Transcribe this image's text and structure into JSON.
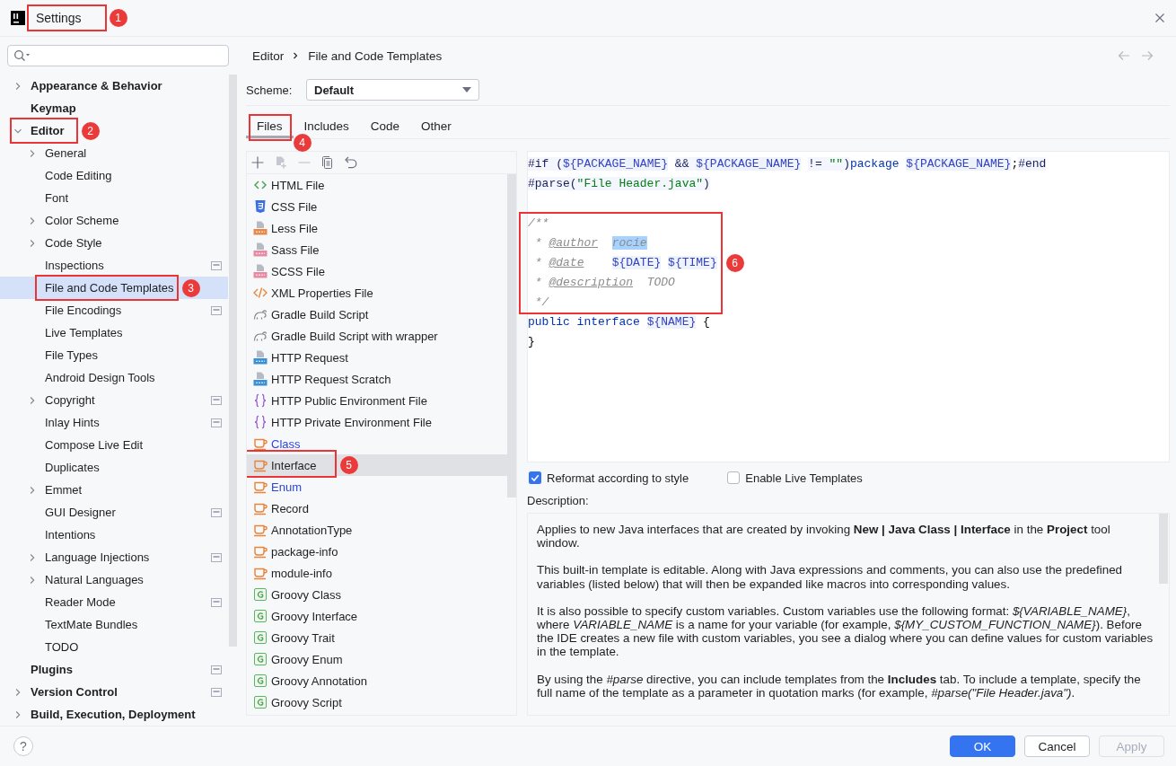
{
  "window": {
    "title": "Settings",
    "callout": "1"
  },
  "sidebar": {
    "items": [
      {
        "label": "Appearance & Behavior",
        "selected": false,
        "expanded": false
      },
      {
        "label": "Keymap",
        "selected": false
      },
      {
        "label": "Editor",
        "selected": false,
        "expanded": true,
        "callout": "2",
        "children": [
          {
            "label": "General",
            "selected": false,
            "expanded": false
          },
          {
            "label": "Code Editing",
            "selected": false
          },
          {
            "label": "Font",
            "selected": false
          },
          {
            "label": "Color Scheme",
            "selected": false,
            "expanded": false
          },
          {
            "label": "Code Style",
            "selected": false,
            "expanded": false
          },
          {
            "label": "Inspections",
            "selected": false,
            "project_level": true
          },
          {
            "label": "File and Code Templates",
            "selected": true,
            "callout": "3"
          },
          {
            "label": "File Encodings",
            "selected": false,
            "project_level": true
          },
          {
            "label": "Live Templates",
            "selected": false
          },
          {
            "label": "File Types",
            "selected": false
          },
          {
            "label": "Android Design Tools",
            "selected": false
          },
          {
            "label": "Copyright",
            "selected": false,
            "expanded": false,
            "project_level": true
          },
          {
            "label": "Inlay Hints",
            "selected": false,
            "project_level": true
          },
          {
            "label": "Compose Live Edit",
            "selected": false
          },
          {
            "label": "Duplicates",
            "selected": false
          },
          {
            "label": "Emmet",
            "selected": false,
            "expanded": false
          },
          {
            "label": "GUI Designer",
            "selected": false,
            "project_level": true
          },
          {
            "label": "Intentions",
            "selected": false
          },
          {
            "label": "Language Injections",
            "selected": false,
            "expanded": false,
            "project_level": true
          },
          {
            "label": "Natural Languages",
            "selected": false,
            "expanded": false
          },
          {
            "label": "Reader Mode",
            "selected": false,
            "project_level": true
          },
          {
            "label": "TextMate Bundles",
            "selected": false
          },
          {
            "label": "TODO",
            "selected": false
          }
        ]
      },
      {
        "label": "Plugins",
        "selected": false,
        "project_level": true
      },
      {
        "label": "Version Control",
        "selected": false,
        "expanded": false,
        "project_level": true
      },
      {
        "label": "Build, Execution, Deployment",
        "selected": false,
        "expanded": false
      }
    ]
  },
  "breadcrumb": {
    "items": [
      "Editor",
      "File and Code Templates"
    ],
    "nav_buttons": [
      {
        "kind": "back",
        "disabled": true
      },
      {
        "kind": "forward",
        "disabled": true
      }
    ]
  },
  "scheme": {
    "label": "Scheme:",
    "value": "Default"
  },
  "tabs": [
    {
      "label": "Files",
      "selected": true,
      "callout": "4"
    },
    {
      "label": "Includes",
      "selected": false
    },
    {
      "label": "Code",
      "selected": false
    },
    {
      "label": "Other",
      "selected": false
    }
  ],
  "templates": {
    "toolbar": [
      {
        "kind": "add",
        "disabled": false
      },
      {
        "kind": "add_child",
        "disabled": true
      },
      {
        "kind": "remove",
        "disabled": true
      },
      {
        "kind": "copy",
        "disabled": false
      },
      {
        "kind": "reset",
        "disabled": false
      }
    ],
    "items": [
      {
        "name": "HTML File",
        "kind": "html",
        "selected": false,
        "modified": false
      },
      {
        "name": "CSS File",
        "kind": "css",
        "selected": false,
        "modified": false
      },
      {
        "name": "Less File",
        "kind": "less",
        "selected": false,
        "modified": false
      },
      {
        "name": "Sass File",
        "kind": "sass",
        "selected": false,
        "modified": false
      },
      {
        "name": "SCSS File",
        "kind": "sass",
        "selected": false,
        "modified": false
      },
      {
        "name": "XML Properties File",
        "kind": "xml",
        "selected": false,
        "modified": false
      },
      {
        "name": "Gradle Build Script",
        "kind": "gradle",
        "selected": false,
        "modified": false
      },
      {
        "name": "Gradle Build Script with wrapper",
        "kind": "gradle",
        "selected": false,
        "modified": false
      },
      {
        "name": "HTTP Request",
        "kind": "api",
        "selected": false,
        "modified": false
      },
      {
        "name": "HTTP Request Scratch",
        "kind": "api",
        "selected": false,
        "modified": false
      },
      {
        "name": "HTTP Public Environment File",
        "kind": "env",
        "selected": false,
        "modified": false
      },
      {
        "name": "HTTP Private Environment File",
        "kind": "env",
        "selected": false,
        "modified": false
      },
      {
        "name": "Class",
        "kind": "java",
        "selected": false,
        "modified": true
      },
      {
        "name": "Interface",
        "kind": "java",
        "selected": true,
        "modified": false,
        "callout": "5"
      },
      {
        "name": "Enum",
        "kind": "java",
        "selected": false,
        "modified": true
      },
      {
        "name": "Record",
        "kind": "java",
        "selected": false,
        "modified": false
      },
      {
        "name": "AnnotationType",
        "kind": "java",
        "selected": false,
        "modified": false
      },
      {
        "name": "package-info",
        "kind": "java",
        "selected": false,
        "modified": false
      },
      {
        "name": "module-info",
        "kind": "java",
        "selected": false,
        "modified": false
      },
      {
        "name": "Groovy Class",
        "kind": "groovy",
        "selected": false,
        "modified": false
      },
      {
        "name": "Groovy Interface",
        "kind": "groovy",
        "selected": false,
        "modified": false
      },
      {
        "name": "Groovy Trait",
        "kind": "groovy",
        "selected": false,
        "modified": false
      },
      {
        "name": "Groovy Enum",
        "kind": "groovy",
        "selected": false,
        "modified": false
      },
      {
        "name": "Groovy Annotation",
        "kind": "groovy",
        "selected": false,
        "modified": false
      },
      {
        "name": "Groovy Script",
        "kind": "groovy",
        "selected": false,
        "modified": false
      }
    ]
  },
  "editor": {
    "blocks": [
      {
        "lines": [
          {
            "kind": "code",
            "tokens": [
              {
                "kind": "directive",
                "text": "#if ("
              },
              {
                "kind": "variable",
                "text": "${PACKAGE_NAME}"
              },
              {
                "kind": "directive",
                "text": " && "
              },
              {
                "kind": "variable",
                "text": "${PACKAGE_NAME}"
              },
              {
                "kind": "directive",
                "text": " != "
              },
              {
                "kind": "string",
                "text": "\"\""
              },
              {
                "kind": "directive",
                "text": ")"
              },
              {
                "kind": "keyword",
                "text": "package "
              },
              {
                "kind": "variable",
                "text": "${PACKAGE_NAME}"
              },
              {
                "kind": "plain",
                "text": ";"
              },
              {
                "kind": "directive",
                "text": "#end"
              }
            ]
          },
          {
            "kind": "code",
            "tokens": [
              {
                "kind": "directive",
                "text": "#parse("
              },
              {
                "kind": "string",
                "text": "\"File Header.java\""
              },
              {
                "kind": "directive",
                "text": ")"
              }
            ]
          },
          {
            "kind": "blank"
          }
        ]
      },
      {
        "callout": "6",
        "lines": [
          {
            "kind": "code",
            "tokens": [
              {
                "kind": "comment",
                "text": "/**"
              }
            ]
          },
          {
            "kind": "code",
            "tokens": [
              {
                "kind": "comment",
                "text": " * "
              },
              {
                "kind": "doc_tag",
                "text": "@author"
              },
              {
                "kind": "selection",
                "text": "  rocie"
              }
            ]
          },
          {
            "kind": "code",
            "tokens": [
              {
                "kind": "comment",
                "text": " * "
              },
              {
                "kind": "doc_tag",
                "text": "@date"
              },
              {
                "kind": "variable",
                "text": "    ${DATE}"
              },
              {
                "kind": "variable",
                "text": " ${TIME}"
              }
            ]
          },
          {
            "kind": "code",
            "tokens": [
              {
                "kind": "comment",
                "text": " * "
              },
              {
                "kind": "doc_tag",
                "text": "@description"
              },
              {
                "kind": "comment",
                "text": "  TODO"
              }
            ]
          },
          {
            "kind": "code",
            "tokens": [
              {
                "kind": "comment",
                "text": " */"
              }
            ]
          }
        ]
      },
      {
        "lines": [
          {
            "kind": "code",
            "tokens": [
              {
                "kind": "keyword",
                "text": "public interface "
              },
              {
                "kind": "variable",
                "text": "${NAME}"
              },
              {
                "kind": "plain",
                "text": " {"
              }
            ]
          },
          {
            "kind": "code",
            "tokens": [
              {
                "kind": "plain",
                "text": "}"
              }
            ]
          }
        ]
      }
    ]
  },
  "options": [
    {
      "label": "Reformat according to style",
      "checked": true
    },
    {
      "label": "Enable Live Templates",
      "checked": false
    }
  ],
  "description": {
    "label": "Description:",
    "paragraphs": [
      "Applies to new Java interfaces that are created by invoking **New | Java Class | Interface** in the **Project** tool window.",
      "This built-in template is editable. Along with Java expressions and comments, you can also use the predefined variables (listed below) that will then be expanded like macros into corresponding values.",
      "It is also possible to specify custom variables. Custom variables use the following format: *${VARIABLE_NAME}*, where *VARIABLE_NAME* is a name for your variable (for example, *${MY_CUSTOM_FUNCTION_NAME}*). Before the IDE creates a new file with custom variables, you see a dialog where you can define values for custom variables in the template.",
      "By using the *#parse* directive, you can include templates from the **Includes** tab. To include a template, specify the full name of the template as a parameter in quotation marks (for example, *#parse(\"File Header.java\")*."
    ]
  },
  "footer": {
    "help": "?",
    "buttons": [
      {
        "label": "OK",
        "kind": "primary",
        "disabled": false
      },
      {
        "label": "Cancel",
        "kind": "secondary",
        "disabled": false
      },
      {
        "label": "Apply",
        "kind": "secondary",
        "disabled": true
      }
    ]
  }
}
